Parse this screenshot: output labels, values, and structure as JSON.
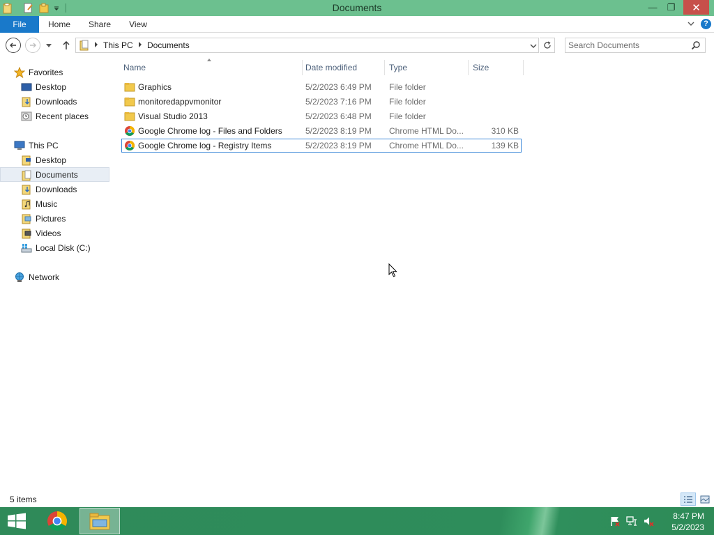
{
  "window": {
    "title": "Documents",
    "minimize_label": "—",
    "maximize_label": "❐",
    "close_label": "✕"
  },
  "ribbon": {
    "tabs": [
      "File",
      "Home",
      "Share",
      "View"
    ],
    "help_label": "?"
  },
  "address": {
    "crumbs": [
      "This PC",
      "Documents"
    ]
  },
  "search": {
    "placeholder": "Search Documents"
  },
  "nav_pane": {
    "favorites": {
      "label": "Favorites",
      "items": [
        "Desktop",
        "Downloads",
        "Recent places"
      ]
    },
    "this_pc": {
      "label": "This PC",
      "items": [
        "Desktop",
        "Documents",
        "Downloads",
        "Music",
        "Pictures",
        "Videos",
        "Local Disk (C:)"
      ],
      "selected": "Documents"
    },
    "network": {
      "label": "Network"
    }
  },
  "file_list": {
    "columns": [
      "Name",
      "Date modified",
      "Type",
      "Size"
    ],
    "sorted_by": "Name",
    "rows": [
      {
        "name": "Graphics",
        "date": "5/2/2023 6:49 PM",
        "type": "File folder",
        "size": "",
        "icon": "folder-icon"
      },
      {
        "name": "monitoredappvmonitor",
        "date": "5/2/2023 7:16 PM",
        "type": "File folder",
        "size": "",
        "icon": "folder-icon"
      },
      {
        "name": "Visual Studio 2013",
        "date": "5/2/2023 6:48 PM",
        "type": "File folder",
        "size": "",
        "icon": "folder-icon"
      },
      {
        "name": "Google Chrome log - Files and Folders",
        "date": "5/2/2023 8:19 PM",
        "type": "Chrome HTML Do...",
        "size": "310 KB",
        "icon": "chrome-icon"
      },
      {
        "name": "Google Chrome log - Registry Items",
        "date": "5/2/2023 8:19 PM",
        "type": "Chrome HTML Do...",
        "size": "139 KB",
        "icon": "chrome-icon"
      }
    ],
    "selected_row": 4
  },
  "status": {
    "item_count": "5 items"
  },
  "taskbar": {
    "time": "8:47 PM",
    "date": "5/2/2023"
  },
  "colors": {
    "titlebar": "#6cc08f",
    "file_tab": "#1979ca",
    "close_button": "#c7504a",
    "selection_border": "#3f8ad9",
    "taskbar": "#2f8a59"
  }
}
